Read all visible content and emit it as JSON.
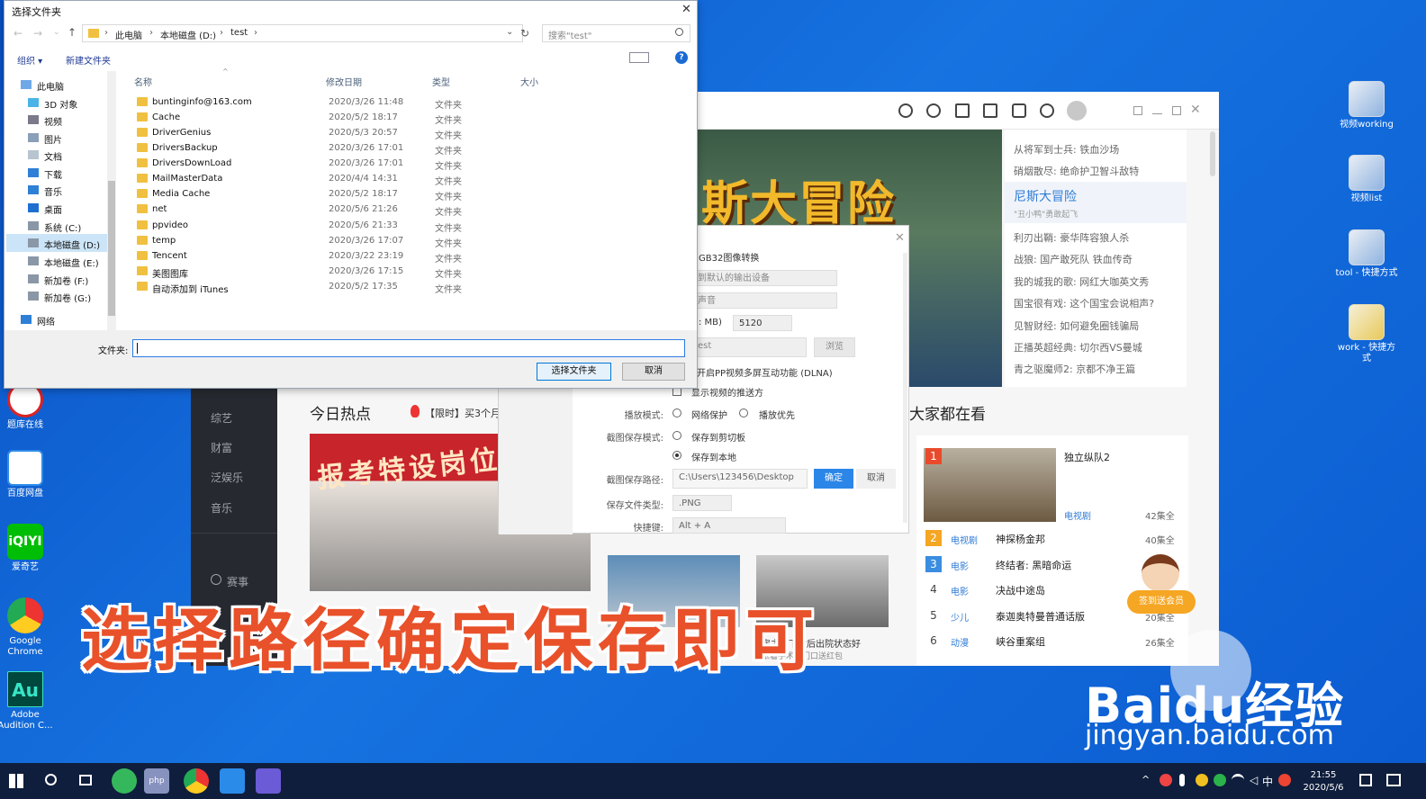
{
  "desktop_right": [
    {
      "label": "视频working"
    },
    {
      "label": "视频list"
    },
    {
      "label": "tool - 快捷方式"
    },
    {
      "label": "work - 快捷方式"
    }
  ],
  "desktop_left": [
    {
      "label": "题库在线"
    },
    {
      "label": "百度网盘"
    },
    {
      "label": "爱奇艺"
    },
    {
      "label": "Google Chrome"
    },
    {
      "label": "Adobe Audition C..."
    }
  ],
  "browser": {
    "banner_title": "斯大冒险",
    "side_list": [
      "从将军到士兵:  铁血沙场",
      "硝烟散尽:  绝命护卫智斗敌特",
      "利刃出鞘:  豪华阵容狼人杀",
      "战狼:  国产敢死队 铁血传奇",
      "我的城我的歌:  网红大咖英文秀",
      "国宝很有戏:  这个国宝会说相声?",
      "见智财经:  如何避免圈钱骗局",
      "正播英超经典:  切尔西VS曼城",
      "青之驱魔师2:  京都不净王篇"
    ],
    "side_highlight_title": "尼斯大冒险",
    "side_highlight_sub": "\"丑小鸭\"勇敢起飞",
    "left_nav": [
      "综艺",
      "财富",
      "泛娱乐",
      "音乐",
      "赛事"
    ],
    "hot_title": "今日热点",
    "hot_limit": "【限时】买3个月",
    "hot_banner": "报考特设岗位",
    "thumb2_caption": "房主明下女后出院状态好",
    "thumb2_sub": "张着手术后门口送红包",
    "watch_title": "大家都在看",
    "ranking": [
      {
        "n": "1",
        "tag": "电视剧",
        "title": "独立纵队2",
        "ep": "42集全"
      },
      {
        "n": "2",
        "tag": "电视剧",
        "title": "神探杨金邦",
        "ep": "40集全"
      },
      {
        "n": "3",
        "tag": "电影",
        "title": "终结者: 黑暗命运",
        "ep": ""
      },
      {
        "n": "4",
        "tag": "电影",
        "title": "决战中途岛",
        "ep": ""
      },
      {
        "n": "5",
        "tag": "少儿",
        "title": "泰迦奥特曼普通话版",
        "ep": "20集全"
      },
      {
        "n": "6",
        "tag": "动漫",
        "title": "峡谷重案组",
        "ep": "26集全"
      }
    ],
    "member_badge": "签到送会员"
  },
  "settings": {
    "gb32": "GB32图像转换",
    "output_device": "到默认的输出设备",
    "voice": "声音",
    "cache_label": ": MB)",
    "cache_value": "5120",
    "path_field": "est",
    "browse": "浏览",
    "dlna": "开启PP视频多屏互动功能 (DLNA)",
    "show_push": "显示视频的推送方",
    "play_mode_label": "播放模式:",
    "play_mode_opt1": "网络保护",
    "play_mode_opt2": "播放优先",
    "shot_mode_label": "截图保存模式:",
    "shot_mode_opt1": "保存到剪切板",
    "shot_mode_opt2": "保存到本地",
    "shot_path_label": "截图保存路径:",
    "shot_path_value": "C:\\Users\\123456\\Desktop",
    "confirm": "确定",
    "cancel": "取消",
    "file_type_label": "保存文件类型:",
    "file_type_value": ".PNG",
    "hotkey_label": "快捷键:",
    "hotkey_value": "Alt + A"
  },
  "file_dialog": {
    "title": "选择文件夹",
    "breadcrumb": [
      "此电脑",
      "本地磁盘 (D:)",
      "test"
    ],
    "search_placeholder": "搜索\"test\"",
    "organize": "组织 ▾",
    "new_folder": "新建文件夹",
    "col_name": "名称",
    "col_date": "修改日期",
    "col_type": "类型",
    "col_size": "大小",
    "nav": [
      "此电脑",
      "3D 对象",
      "视频",
      "图片",
      "文档",
      "下载",
      "音乐",
      "桌面",
      "系统 (C:)",
      "本地磁盘 (D:)",
      "本地磁盘 (E:)",
      "新加卷 (F:)",
      "新加卷 (G:)",
      "网络"
    ],
    "files": [
      {
        "name": "buntinginfo@163.com",
        "date": "2020/3/26 11:48",
        "type": "文件夹"
      },
      {
        "name": "Cache",
        "date": "2020/5/2 18:17",
        "type": "文件夹"
      },
      {
        "name": "DriverGenius",
        "date": "2020/5/3 20:57",
        "type": "文件夹"
      },
      {
        "name": "DriversBackup",
        "date": "2020/3/26 17:01",
        "type": "文件夹"
      },
      {
        "name": "DriversDownLoad",
        "date": "2020/3/26 17:01",
        "type": "文件夹"
      },
      {
        "name": "MailMasterData",
        "date": "2020/4/4 14:31",
        "type": "文件夹"
      },
      {
        "name": "Media Cache",
        "date": "2020/5/2 18:17",
        "type": "文件夹"
      },
      {
        "name": "net",
        "date": "2020/5/6 21:26",
        "type": "文件夹"
      },
      {
        "name": "ppvideo",
        "date": "2020/5/6 21:33",
        "type": "文件夹"
      },
      {
        "name": "temp",
        "date": "2020/3/26 17:07",
        "type": "文件夹"
      },
      {
        "name": "Tencent",
        "date": "2020/3/22 23:19",
        "type": "文件夹"
      },
      {
        "name": "美图图库",
        "date": "2020/3/26 17:15",
        "type": "文件夹"
      },
      {
        "name": "自动添加到 iTunes",
        "date": "2020/5/2 17:35",
        "type": "文件夹"
      }
    ],
    "folder_label": "文件夹:",
    "folder_value": "",
    "select_btn": "选择文件夹",
    "cancel_btn": "取消"
  },
  "caption": "选择路径确定保存即可",
  "watermark": {
    "logo": "Baidu经验",
    "url": "jingyan.baidu.com"
  },
  "taskbar": {
    "time": "21:55",
    "date": "2020/5/6",
    "ime": "中"
  }
}
